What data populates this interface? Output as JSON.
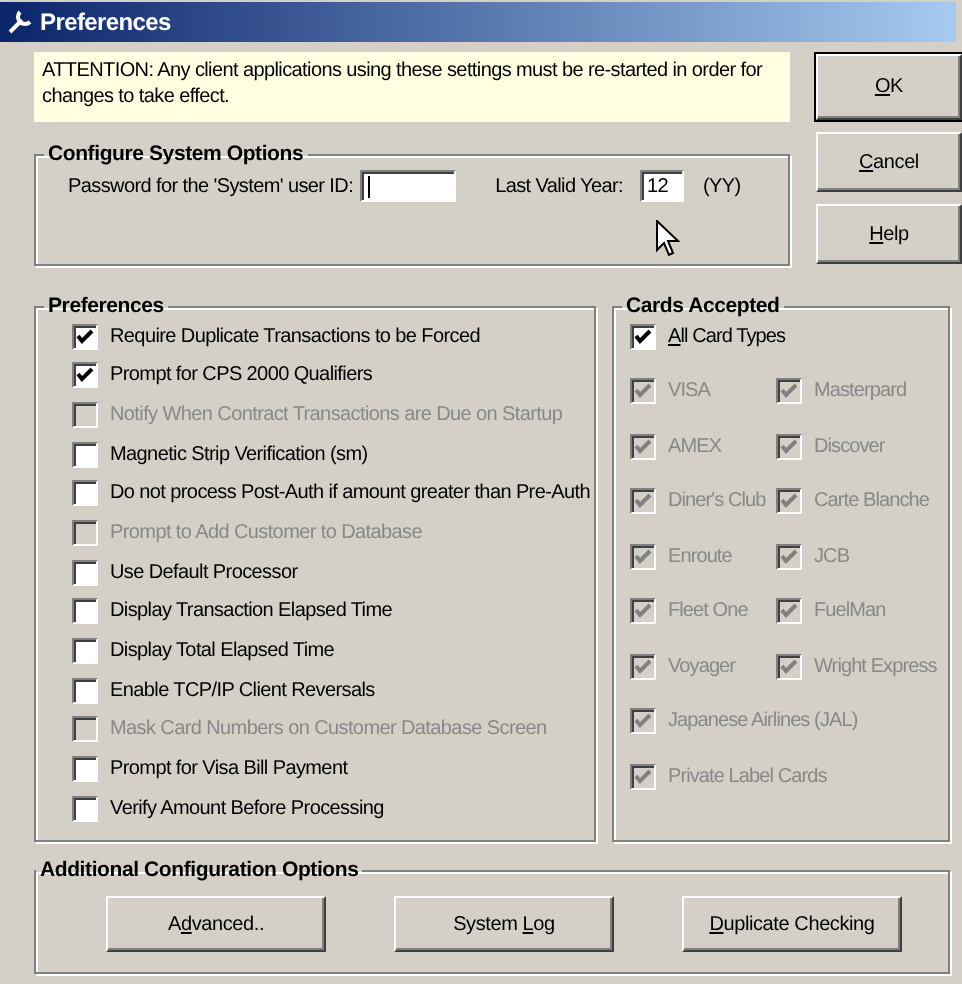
{
  "window": {
    "title": "Preferences"
  },
  "notice": "ATTENTION:  Any client applications using these settings must be re-started in order for changes to take effect.",
  "dialog_buttons": [
    {
      "key": "O",
      "after": "K"
    },
    {
      "key": "C",
      "after": "ancel"
    },
    {
      "key": "H",
      "after": "elp"
    }
  ],
  "system_options": {
    "title": "Configure System Options",
    "password_label": "Password for the 'System' user ID:",
    "year_label": "Last Valid Year:",
    "year_value": "12",
    "year_hint": "(YY)"
  },
  "preferences": {
    "title": "Preferences",
    "items": [
      {
        "label": "Require Duplicate Transactions to be Forced",
        "checked": true,
        "disabled": false
      },
      {
        "label": "Prompt for CPS 2000 Qualifiers",
        "checked": true,
        "disabled": false
      },
      {
        "label": "Notify When Contract Transactions are Due on Startup",
        "checked": false,
        "disabled": true
      },
      {
        "label": "Magnetic Strip Verification (sm)",
        "checked": false,
        "disabled": false
      },
      {
        "label": "Do not process Post-Auth if amount greater than Pre-Auth",
        "checked": false,
        "disabled": false
      },
      {
        "label": "Prompt to Add Customer to Database",
        "checked": false,
        "disabled": true
      },
      {
        "label": "Use Default Processor",
        "checked": false,
        "disabled": false
      },
      {
        "label": "Display Transaction Elapsed Time",
        "checked": false,
        "disabled": false
      },
      {
        "label": "Display Total Elapsed Time",
        "checked": false,
        "disabled": false
      },
      {
        "label": "Enable TCP/IP Client Reversals",
        "checked": false,
        "disabled": false
      },
      {
        "label": "Mask Card Numbers on Customer Database Screen",
        "checked": false,
        "disabled": true
      },
      {
        "label": "Prompt for Visa Bill Payment",
        "checked": false,
        "disabled": false
      },
      {
        "label": "Verify Amount Before Processing",
        "checked": false,
        "disabled": false
      }
    ]
  },
  "cards": {
    "title": "Cards Accepted",
    "all": {
      "key": "A",
      "after": "ll Card Types",
      "checked": true,
      "disabled": false
    },
    "rows": [
      [
        {
          "label": "VISA",
          "checked": true,
          "disabled": true
        },
        {
          "label": "Masterpard",
          "checked": true,
          "disabled": true
        }
      ],
      [
        {
          "label": "AMEX",
          "checked": true,
          "disabled": true
        },
        {
          "label": "Discover",
          "checked": true,
          "disabled": true
        }
      ],
      [
        {
          "label": "Diner's Club",
          "checked": true,
          "disabled": true
        },
        {
          "label": "Carte Blanche",
          "checked": true,
          "disabled": true
        }
      ],
      [
        {
          "label": "Enroute",
          "checked": true,
          "disabled": true
        },
        {
          "label": "JCB",
          "checked": true,
          "disabled": true
        }
      ],
      [
        {
          "label": "Fleet One",
          "checked": true,
          "disabled": true
        },
        {
          "label": "FuelMan",
          "checked": true,
          "disabled": true
        }
      ],
      [
        {
          "label": "Voyager",
          "checked": true,
          "disabled": true
        },
        {
          "label": "Wright Express",
          "checked": true,
          "disabled": true
        }
      ],
      [
        {
          "label": "Japanese Airlines (JAL)",
          "checked": true,
          "disabled": true
        }
      ],
      [
        {
          "label": "Private Label Cards",
          "checked": true,
          "disabled": true
        }
      ]
    ]
  },
  "additional": {
    "title": "Additional Configuration Options",
    "buttons": [
      {
        "before": "A",
        "key": "d",
        "after": "vanced.."
      },
      {
        "before": "System ",
        "key": "L",
        "after": "og"
      },
      {
        "key": "D",
        "after": "uplicate Checking"
      }
    ]
  }
}
